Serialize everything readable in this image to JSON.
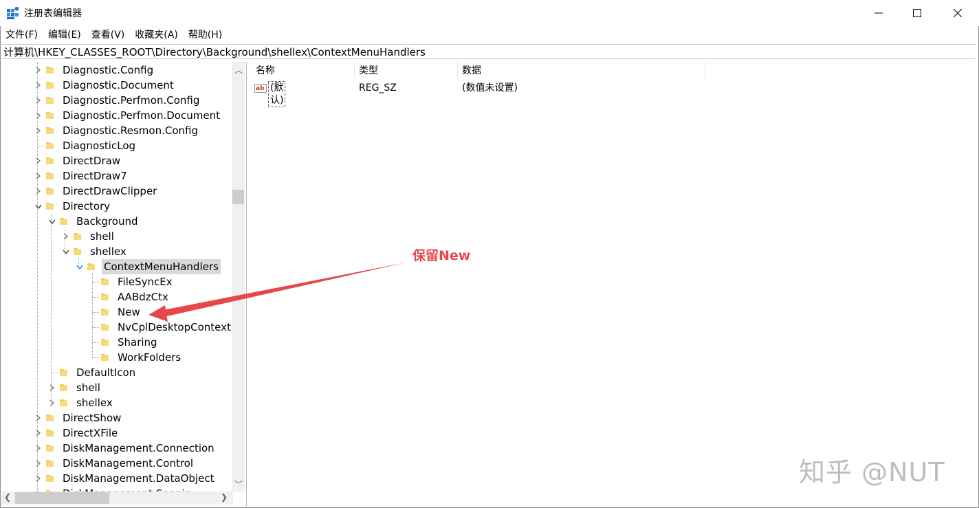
{
  "window": {
    "title": "注册表编辑器"
  },
  "menu": [
    "文件(F)",
    "编辑(E)",
    "查看(V)",
    "收藏夹(A)",
    "帮助(H)"
  ],
  "address": "计算机\\HKEY_CLASSES_ROOT\\Directory\\Background\\shellex\\ContextMenuHandlers",
  "tree": [
    {
      "label": "Diagnostic.Config",
      "level": 0,
      "expander": "collapsed"
    },
    {
      "label": "Diagnostic.Document",
      "level": 0,
      "expander": "collapsed"
    },
    {
      "label": "Diagnostic.Perfmon.Config",
      "level": 0,
      "expander": "collapsed"
    },
    {
      "label": "Diagnostic.Perfmon.Document",
      "level": 0,
      "expander": "collapsed"
    },
    {
      "label": "Diagnostic.Resmon.Config",
      "level": 0,
      "expander": "collapsed"
    },
    {
      "label": "DiagnosticLog",
      "level": 0,
      "expander": "none"
    },
    {
      "label": "DirectDraw",
      "level": 0,
      "expander": "collapsed"
    },
    {
      "label": "DirectDraw7",
      "level": 0,
      "expander": "collapsed"
    },
    {
      "label": "DirectDrawClipper",
      "level": 0,
      "expander": "collapsed"
    },
    {
      "label": "Directory",
      "level": 0,
      "expander": "expanded"
    },
    {
      "label": "Background",
      "level": 1,
      "expander": "expanded"
    },
    {
      "label": "shell",
      "level": 2,
      "expander": "collapsed"
    },
    {
      "label": "shellex",
      "level": 2,
      "expander": "expanded"
    },
    {
      "label": "ContextMenuHandlers",
      "level": 3,
      "expander": "expanded-focus",
      "selected": true
    },
    {
      "label": "FileSyncEx",
      "level": 4,
      "expander": "none"
    },
    {
      "label": "AABdzCtx",
      "level": 4,
      "expander": "none"
    },
    {
      "label": "New",
      "level": 4,
      "expander": "none"
    },
    {
      "label": "NvCplDesktopContext",
      "level": 4,
      "expander": "none"
    },
    {
      "label": "Sharing",
      "level": 4,
      "expander": "none"
    },
    {
      "label": "WorkFolders",
      "level": 4,
      "expander": "none"
    },
    {
      "label": "DefaultIcon",
      "level": 1,
      "expander": "none"
    },
    {
      "label": "shell",
      "level": 1,
      "expander": "collapsed"
    },
    {
      "label": "shellex",
      "level": 1,
      "expander": "collapsed"
    },
    {
      "label": "DirectShow",
      "level": 0,
      "expander": "collapsed"
    },
    {
      "label": "DirectXFile",
      "level": 0,
      "expander": "collapsed"
    },
    {
      "label": "DiskManagement.Connection",
      "level": 0,
      "expander": "collapsed"
    },
    {
      "label": "DiskManagement.Control",
      "level": 0,
      "expander": "collapsed"
    },
    {
      "label": "DiskManagement.DataObject",
      "level": 0,
      "expander": "collapsed"
    },
    {
      "label": "DiskManagement.Snapin",
      "level": 0,
      "expander": "collapsed"
    }
  ],
  "columns": {
    "name": "名称",
    "type": "类型",
    "data": "数据"
  },
  "values": [
    {
      "name": "(默认)",
      "type": "REG_SZ",
      "data": "(数值未设置)",
      "icon": "string-value-icon"
    }
  ],
  "annotation": {
    "text": "保留New",
    "color": "#e5474b"
  },
  "watermark": "知乎 @NUT",
  "colors": {
    "folder": "#f2c94c",
    "selection": "#d9d9d9",
    "focus_chevron": "#1e90ff"
  }
}
